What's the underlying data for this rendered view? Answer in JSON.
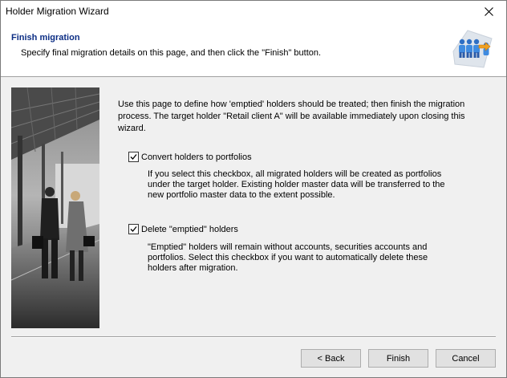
{
  "window": {
    "title": "Holder Migration Wizard"
  },
  "header": {
    "title": "Finish migration",
    "subtitle": "Specify final migration details on this page, and then click the \"Finish\" button."
  },
  "intro": {
    "line1": "Use this page to define how 'emptied' holders should be treated; then finish the migration",
    "line2": "process. The target holder \"Retail client A\" will be available immediately upon closing this wizard."
  },
  "options": [
    {
      "label": "Convert holders to portfolios",
      "checked": true,
      "description": [
        "If you select this checkbox, all migrated holders will be created as portfolios",
        "under the target holder. Existing holder master data will be transferred to the",
        "new portfolio master data to the extent possible."
      ]
    },
    {
      "label": "Delete \"emptied\" holders",
      "checked": true,
      "description": [
        "\"Emptied\" holders will remain without accounts, securities accounts and",
        "portfolios. Select this checkbox if you want to automatically delete these",
        "holders after migration."
      ]
    }
  ],
  "buttons": {
    "back": "< Back",
    "finish": "Finish",
    "cancel": "Cancel"
  },
  "icons": {
    "close": "close-icon",
    "check": "checkmark-icon",
    "logo": "holder-migration-icon"
  },
  "colors": {
    "header_title": "#0b2d84",
    "window_bg": "#f0f0f0"
  }
}
